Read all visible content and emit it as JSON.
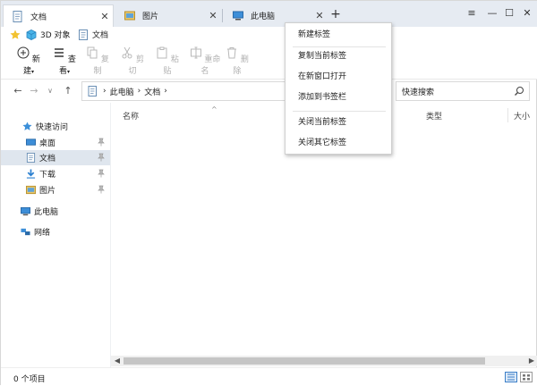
{
  "tabs": [
    {
      "label": "文档",
      "close": "✕",
      "icon": "document-icon"
    },
    {
      "label": "图片",
      "close": "✕",
      "icon": "picture-folder-icon"
    },
    {
      "label": "此电脑",
      "close": "✕",
      "icon": "computer-icon"
    }
  ],
  "new_tab": "+",
  "window_controls": {
    "menu": "≡",
    "minimize": "—",
    "maximize": "☐",
    "close": "✕"
  },
  "favorites": [
    {
      "label": "3D 对象",
      "icon": "cube-3d-icon"
    },
    {
      "label": "文档",
      "icon": "document-icon"
    }
  ],
  "favorites_star": "star-icon",
  "ribbon": [
    {
      "label": "新建",
      "caret": "▾",
      "enabled": true,
      "icon": "new-icon"
    },
    {
      "label": "查看",
      "caret": "▾",
      "enabled": true,
      "icon": "view-icon"
    },
    {
      "label": "复制",
      "enabled": false,
      "icon": "copy-icon"
    },
    {
      "label": "剪切",
      "enabled": false,
      "icon": "cut-icon"
    },
    {
      "label": "粘贴",
      "enabled": false,
      "icon": "paste-icon"
    },
    {
      "label": "重命名",
      "enabled": false,
      "icon": "rename-icon"
    },
    {
      "label": "删除",
      "enabled": false,
      "icon": "delete-icon"
    }
  ],
  "nav": {
    "back": "←",
    "forward": "→",
    "dropdown": "∨",
    "up": "↑"
  },
  "address": {
    "parts": [
      "此电脑",
      "文档"
    ],
    "separator": "›"
  },
  "search": {
    "placeholder": "快速搜索"
  },
  "sidebar": [
    {
      "label": "快速访问",
      "icon": "star-icon"
    },
    {
      "label": "桌面",
      "icon": "desktop-icon",
      "pinned": true
    },
    {
      "label": "文档",
      "icon": "document-icon",
      "pinned": true,
      "selected": true
    },
    {
      "label": "下载",
      "icon": "download-icon",
      "pinned": true
    },
    {
      "label": "图片",
      "icon": "picture-folder-icon",
      "pinned": true
    },
    {
      "label": "此电脑",
      "icon": "computer-icon"
    },
    {
      "label": "网络",
      "icon": "network-icon"
    }
  ],
  "columns": [
    {
      "label": "名称"
    },
    {
      "label": "类型"
    },
    {
      "label": "大小"
    }
  ],
  "sort_indicator": "^",
  "status": {
    "text": "0 个项目"
  },
  "context_menu": [
    {
      "label": "新建标签"
    },
    {
      "label": "复制当前标签"
    },
    {
      "label": "在新窗口打开"
    },
    {
      "label": "添加到书签栏"
    },
    {
      "label": "关闭当前标签"
    },
    {
      "label": "关闭其它标签"
    }
  ],
  "colors": {
    "accent": "#3c7fc8",
    "tabbar": "#e6ebf2",
    "selected": "#dfe6ee"
  }
}
